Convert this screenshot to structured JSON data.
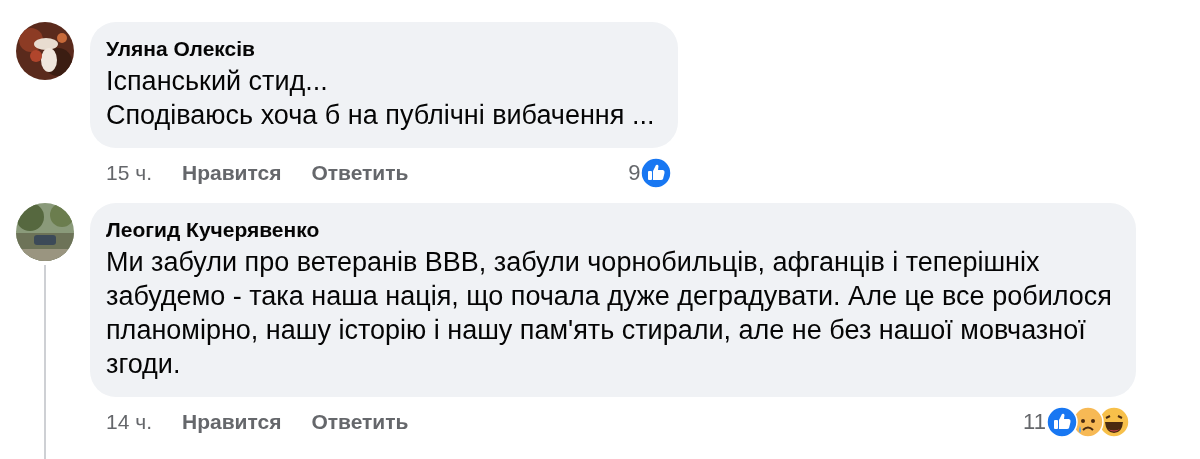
{
  "comments": [
    {
      "author": "Уляна Олексів",
      "avatar": {
        "kind": "picture"
      },
      "lines": [
        "Іспанський стид...",
        "Сподіваюсь хоча б на публічні вибачення ..."
      ],
      "thread_line": false,
      "time": "15 ч.",
      "like": "Нравится",
      "reply": "Ответить",
      "reactions": {
        "count": "9",
        "icons": [
          {
            "kind": "like"
          }
        ]
      }
    },
    {
      "author": "Леогид Кучерявенко",
      "avatar": {
        "kind": "picture"
      },
      "lines": [
        "Ми забули про ветеранів ВВВ, забули чорнобильців, афганців і теперішніх",
        "забудемо - така наша нація, що почала дуже деградувати. Але це все робилося",
        "планомірно, нашу історію і нашу пам'ять стирали, але не без нашої мовчазної",
        "згоди."
      ],
      "thread_line": true,
      "time": "14 ч.",
      "like": "Нравится",
      "reply": "Ответить",
      "reactions": {
        "count": "11",
        "icons": [
          {
            "kind": "like"
          },
          {
            "kind": "sad"
          },
          {
            "kind": "haha"
          }
        ]
      }
    }
  ]
}
